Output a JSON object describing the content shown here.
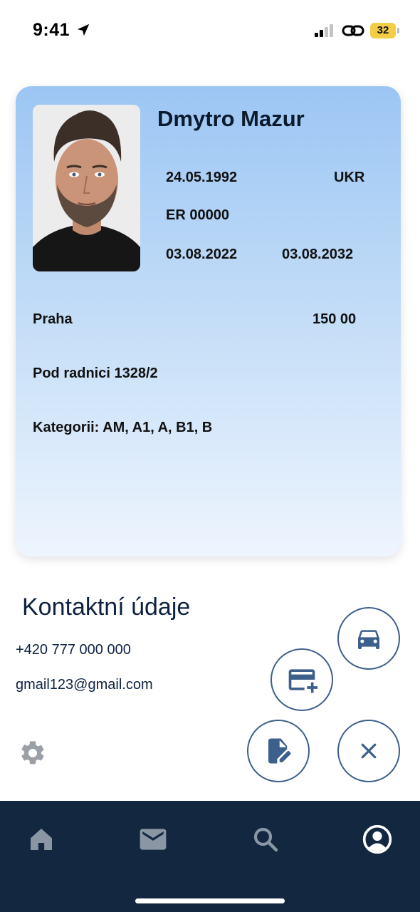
{
  "status_bar": {
    "time": "9:41",
    "battery": "32"
  },
  "license": {
    "name": "Dmytro Mazur",
    "birth_date": "24.05.1992",
    "nationality": "UKR",
    "document_number": "ER 00000",
    "issue_date": "03.08.2022",
    "expiry_date": "03.08.2032",
    "city": "Praha",
    "postal_code": "150 00",
    "street": "Pod radnici 1328/2",
    "categories": "Kategorii: AM, A1, A, B1, B"
  },
  "contact": {
    "title": "Kontaktní údaje",
    "phone": "+420 777 000 000",
    "email": "gmail123@gmail.com"
  },
  "actions": [
    "car-icon",
    "add-card-icon",
    "edit-document-icon",
    "close-icon",
    "gear-icon"
  ],
  "nav": [
    "home-icon",
    "mail-icon",
    "search-icon",
    "profile-icon"
  ],
  "colors": {
    "nav_bg": "#132840",
    "accent": "#3d5f8c",
    "card_top": "#9cc6f4",
    "battery": "#f2cd45"
  }
}
